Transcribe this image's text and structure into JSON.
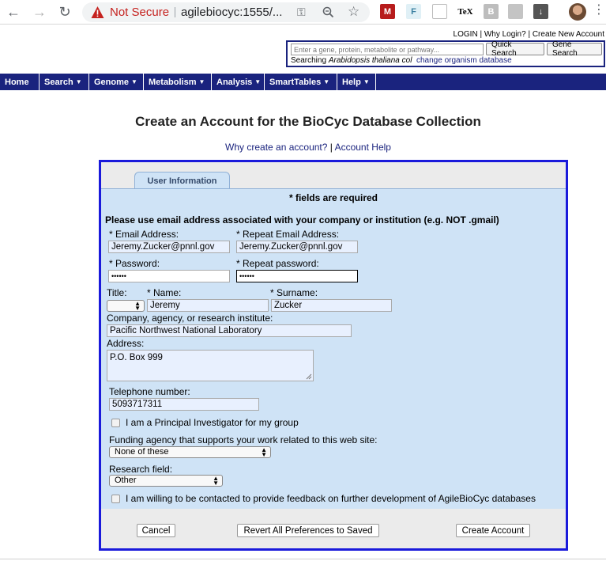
{
  "browser": {
    "security_label": "Not Secure",
    "url": "agilebiocyc:1555/...",
    "extensions": [
      "M",
      "F",
      "TeX",
      "B"
    ]
  },
  "header": {
    "login": "LOGIN",
    "why_login": "Why Login?",
    "create_account": "Create New Account",
    "search_placeholder": "Enter a gene, protein, metabolite or pathway...",
    "quick_search": "Quick Search",
    "gene_search": "Gene Search",
    "searching_prefix": "Searching",
    "organism": "Arabidopsis thaliana col",
    "change_db": "change organism database"
  },
  "menubar": [
    {
      "label": "Home",
      "dropdown": false
    },
    {
      "label": "Search",
      "dropdown": true
    },
    {
      "label": "Genome",
      "dropdown": true
    },
    {
      "label": "Metabolism",
      "dropdown": true
    },
    {
      "label": "Analysis",
      "dropdown": true
    },
    {
      "label": "SmartTables",
      "dropdown": true
    },
    {
      "label": "Help",
      "dropdown": true
    }
  ],
  "page": {
    "title": "Create an Account for the BioCyc Database Collection",
    "why_create": "Why create an account?",
    "separator": "|",
    "account_help": "Account Help"
  },
  "form": {
    "tab": "User Information",
    "required_note": "* fields are required",
    "email_note": "Please use email address associated with your company or institution (e.g. NOT .gmail)",
    "email_label": "* Email Address:",
    "email_value": "Jeremy.Zucker@pnnl.gov",
    "repeat_email_label": "* Repeat Email Address:",
    "repeat_email_value": "Jeremy.Zucker@pnnl.gov",
    "password_label": "* Password:",
    "password_value": "••••••",
    "repeat_password_label": "* Repeat password:",
    "repeat_password_value": "••••••",
    "title_label": "Title:",
    "title_value": "",
    "name_label": "* Name:",
    "name_value": "Jeremy",
    "surname_label": "* Surname:",
    "surname_value": "Zucker",
    "company_label": "Company, agency, or research institute:",
    "company_value": "Pacific Northwest National Laboratory",
    "address_label": "Address:",
    "address_value": "P.O. Box 999",
    "phone_label": "Telephone number:",
    "phone_value": "5093717311",
    "pi_label": "I am a Principal Investigator for my group",
    "funding_label": "Funding agency that supports your work related to this web site:",
    "funding_value": "None of these",
    "research_label": "Research field:",
    "research_value": "Other",
    "feedback_label": "I am willing to be contacted to provide feedback on further development of AgileBioCyc databases",
    "cancel": "Cancel",
    "revert": "Revert All Preferences to Saved",
    "create": "Create Account"
  },
  "colors": {
    "navy": "#1a237e",
    "form_border": "#1a1adb",
    "form_bg": "#cfe3f6",
    "warning_red": "#c5221f"
  }
}
